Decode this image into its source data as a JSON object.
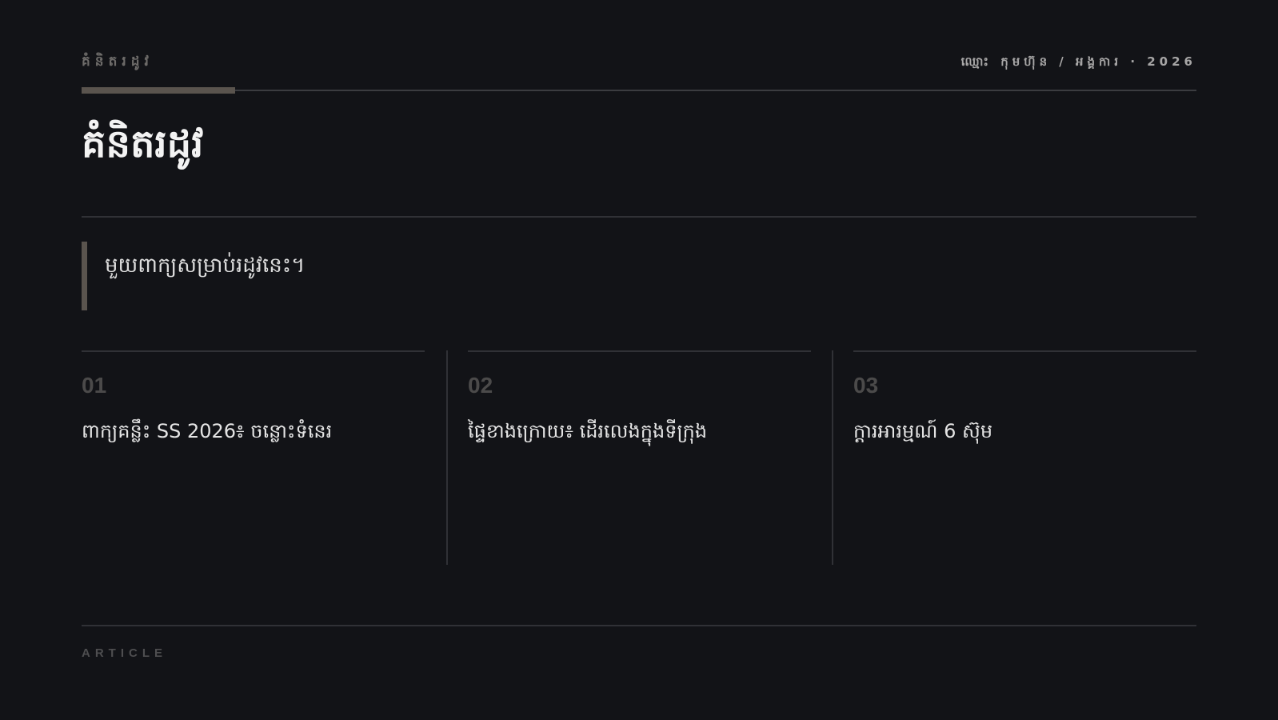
{
  "header": {
    "kicker": "គំនិតរដូវ",
    "meta": "ឈ្មោះ កុមហ៊ុន / អង្គការ · 2026"
  },
  "title": "គំនិតរដូវ",
  "lede": "មួយពាក្យសម្រាប់រដូវនេះ។",
  "columns": [
    {
      "num": "01",
      "text": "ពាក្យគន្លឹះ SS 2026៖ ចន្លោះទំនេរ"
    },
    {
      "num": "02",
      "text": "ផ្ទៃខាងក្រោយ៖ ដើរលេងក្នុងទីក្រុង"
    },
    {
      "num": "03",
      "text": "ក្តារអារម្មណ៍ 6 ស៊ុម"
    }
  ],
  "footer": "ARTICLE",
  "colors": {
    "background": "#121317",
    "accent": "#5a544e",
    "rule": "#303136"
  }
}
